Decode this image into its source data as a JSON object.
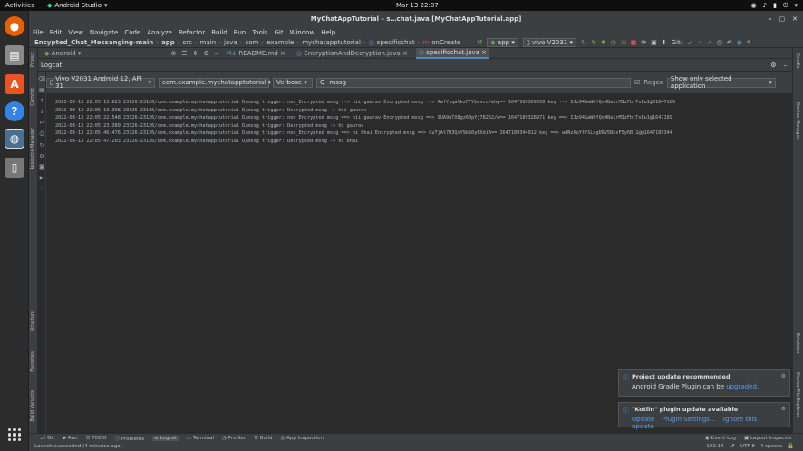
{
  "os": {
    "activities": "Activities",
    "app_name": "Android Studio",
    "clock": "Mar 13 22:07",
    "dock": [
      {
        "icon": "firefox-icon",
        "color": "#e66000"
      },
      {
        "icon": "files-icon",
        "color": "#8a8a8a"
      },
      {
        "icon": "software-icon",
        "color": "#e95420"
      },
      {
        "icon": "help-icon",
        "color": "#3584e4"
      },
      {
        "icon": "android-studio-icon",
        "color": "#3ddc84"
      },
      {
        "icon": "disk-icon",
        "color": "#777777"
      }
    ]
  },
  "window": {
    "title": "MyChatAppTutorial – s…chat.java [MyChatAppTutorial.app]",
    "menu": [
      "File",
      "Edit",
      "View",
      "Navigate",
      "Code",
      "Analyze",
      "Refactor",
      "Build",
      "Run",
      "Tools",
      "Git",
      "Window",
      "Help"
    ]
  },
  "breadcrumb": [
    "Encypted_Chat_Messanging-main",
    "app",
    "src",
    "main",
    "java",
    "com",
    "example",
    "mychatapptutorial",
    "specificchat",
    "onCreate"
  ],
  "toolbar": {
    "run_config": "app",
    "device": "vivo V2031",
    "git_label": "Git:"
  },
  "left_tabs": [
    "Project",
    "Commit",
    "Resource Manager",
    "Structure",
    "Favorites",
    "Build Variants"
  ],
  "right_tabs": [
    "Gradle",
    "Device Manager",
    "Emulator",
    "Device File Explorer"
  ],
  "editor_tabs": [
    "Android",
    "README.md",
    "EncryptionAndDecryption.java",
    "specificchat.java"
  ],
  "logcat": {
    "title": "Logcat",
    "device": "Vivo V2031 Android 12, API 31",
    "package": "com.example.mychatapptutorial",
    "level": "Verbose",
    "search": "Q- mssg",
    "regex_label": "Regex",
    "app_filter": "Show only selected application",
    "lines": [
      "2022-03-13 22:05:13.623 23126-23126/com.example.mychatapptutorial D/mssg trigger:  non_Encrypted mssg --> hii gaurav Encrypted mssg --> AwfYxqwlkzFFYbavcc/ehg== 1647189369059 key --> IJz94GaWhfQoM8a1rMIzFbtTsEu1@01647189",
      "2022-03-13 22:05:13.398 23126-23126/com.example.mychatapptutorial D/mssg trigger:  Decrypted mssg -> hii gaurav",
      "2022-03-13 22:05:22.548 23126-23126/com.example.mychatapptutorial D/mssg trigger:  non_Encrypted mssg ==> hii gaurav Encrypted mssg ==> 9UA9uTX8gz60pYj78262/w== 1647189328971 key ==> IJz94GaWhfQoM8a1rMIzFbtTsEu1@1647189",
      "2022-03-13 22:05:23.389 23126-23126/com.example.mychatapptutorial D/mssg trigger:  Decrypted mssg -> hi gaurav",
      "2022-03-13 22:05:46.476 23126-23126/com.example.mychatapptutorial D/mssg trigger:  non_Encrypted mssg ==> hi bhai Encrypted mssg ==> QuTjAt7B3QxY9bS0yBXdiA== 1647189344912 key ==> wdNzXuYfYSLvgDRV5BksF5y6Bl1@@1647189344",
      "2022-03-13 22:05:47.203 23126-23126/com.example.mychatapptutorial D/mssg trigger:  Decrypted mssg -> hi bhai"
    ]
  },
  "notifications": [
    {
      "title": "Project update recommended",
      "text": "Android Gradle Plugin can be",
      "links": [
        "upgraded."
      ]
    },
    {
      "title": "\"Kotlin\" plugin update available",
      "text": "",
      "links": [
        "Update",
        "Plugin Settings...",
        "Ignore this update"
      ]
    }
  ],
  "bottom_tabs": [
    "Git",
    "Run",
    "TODO",
    "Problems",
    "Logcat",
    "Terminal",
    "Profiler",
    "Build",
    "App Inspection"
  ],
  "bottom_right": [
    "Event Log",
    "Layout Inspector"
  ],
  "status": {
    "message": "Launch succeeded (4 minutes ago)",
    "position": "102:14",
    "line_sep": "LF",
    "encoding": "UTF-8",
    "indent": "4 spaces"
  }
}
